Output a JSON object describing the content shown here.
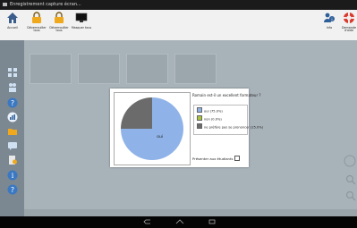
{
  "window": {
    "title": "Enregistrement capture écran..."
  },
  "toolbar": {
    "accueil": "Accueil",
    "deverrouiller_tous": "Déverrouiller tous",
    "deverrouiller_tous2": "Déverrouiller tous",
    "masquer_tous": "Masquer tous",
    "info": "Info",
    "demande_aide": "Demande d'aide"
  },
  "poll": {
    "question": "Romain est-il un excellent formateur ?",
    "present_label": "Présenter aux étudiants",
    "present_checked": false
  },
  "chart_data": {
    "type": "pie",
    "categories": [
      "oui (75.0%)",
      "non (0.0%)",
      "ne préfère pas se prononcer (25.0%)"
    ],
    "values": [
      75.0,
      0.0,
      25.0
    ],
    "colors": [
      "#8fb3e8",
      "#a8c43a",
      "#6b6b6b"
    ],
    "labels": [
      "oui",
      "",
      ""
    ],
    "title": "",
    "legend_position": "right"
  },
  "icons": {
    "home": "home-icon",
    "lock": "lock-icon",
    "monitor": "monitor-icon",
    "info": "users-icon",
    "help": "lifebuoy-icon"
  },
  "colors": {
    "sidebar": "#7b8892",
    "main": "#a8b2b9",
    "dialog": "#ffffff"
  }
}
